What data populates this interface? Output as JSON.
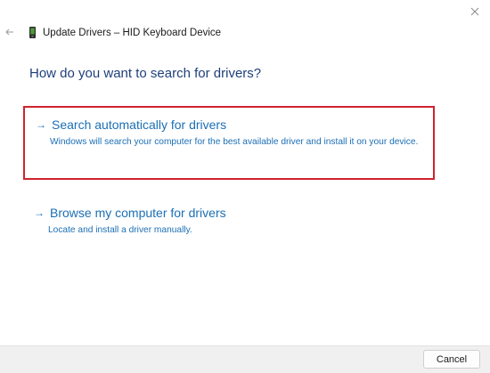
{
  "window": {
    "title": "Update Drivers – HID Keyboard Device"
  },
  "icons": {
    "close": "close-icon",
    "back": "back-arrow-icon",
    "device": "keyboard-device-icon",
    "option_arrow": "arrow-right-icon"
  },
  "heading": "How do you want to search for drivers?",
  "options": [
    {
      "arrow": "→",
      "title": "Search automatically for drivers",
      "description": "Windows will search your computer for the best available driver and install it on your device."
    },
    {
      "arrow": "→",
      "title": "Browse my computer for drivers",
      "description": "Locate and install a driver manually."
    }
  ],
  "footer": {
    "cancel_label": "Cancel"
  },
  "colors": {
    "link": "#1b6fb5",
    "heading": "#1e3f7a",
    "highlight_border": "#d0232e",
    "footer_bg": "#f0f0f0"
  }
}
